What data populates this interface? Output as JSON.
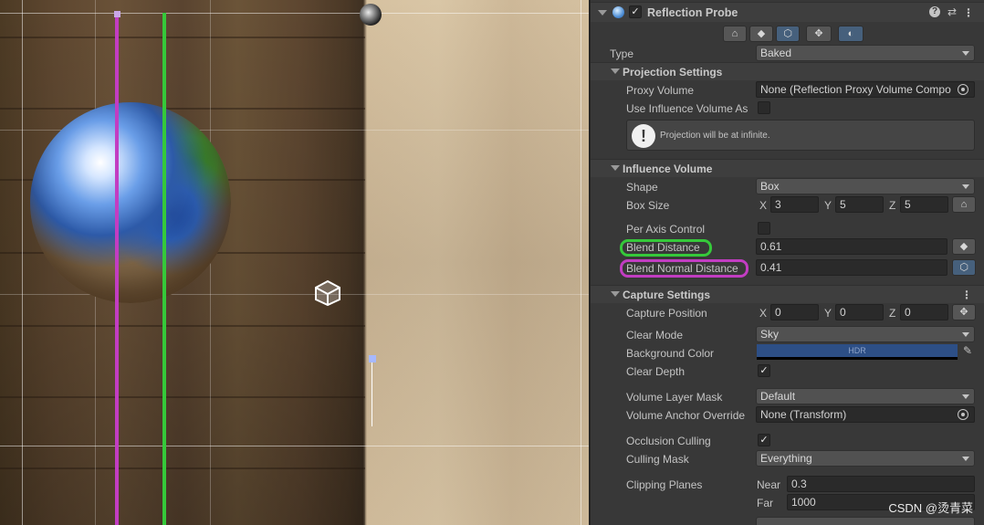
{
  "component": {
    "title": "Reflection Probe",
    "enabled": true
  },
  "type": {
    "label": "Type",
    "value": "Baked"
  },
  "projection": {
    "title": "Projection Settings",
    "proxy_volume_label": "Proxy Volume",
    "proxy_volume_value": "None (Reflection Proxy Volume Compo",
    "use_influence_label": "Use Influence Volume As",
    "use_influence_checked": false,
    "help_text": "Projection will be at infinite."
  },
  "influence": {
    "title": "Influence Volume",
    "shape_label": "Shape",
    "shape_value": "Box",
    "box_size_label": "Box Size",
    "box_size": {
      "x": "3",
      "y": "5",
      "z": "5"
    },
    "per_axis_label": "Per Axis Control",
    "per_axis_checked": false,
    "blend_distance_label": "Blend Distance",
    "blend_distance_value": "0.61",
    "blend_normal_label": "Blend Normal Distance",
    "blend_normal_value": "0.41"
  },
  "capture": {
    "title": "Capture Settings",
    "capture_position_label": "Capture Position",
    "capture_position": {
      "x": "0",
      "y": "0",
      "z": "0"
    },
    "clear_mode_label": "Clear Mode",
    "clear_mode_value": "Sky",
    "background_color_label": "Background Color",
    "background_color_tag": "HDR",
    "background_color_hex": "#2d4f86",
    "clear_depth_label": "Clear Depth",
    "clear_depth_checked": true,
    "volume_layer_mask_label": "Volume Layer Mask",
    "volume_layer_mask_value": "Default",
    "volume_anchor_label": "Volume Anchor Override",
    "volume_anchor_value": "None (Transform)",
    "occlusion_culling_label": "Occlusion Culling",
    "occlusion_culling_checked": true,
    "culling_mask_label": "Culling Mask",
    "culling_mask_value": "Everything",
    "clipping_planes_label": "Clipping Planes",
    "near_label": "Near",
    "near_value": "0.3",
    "far_label": "Far",
    "far_value": "1000"
  },
  "axis_labels": {
    "x": "X",
    "y": "Y",
    "z": "Z"
  },
  "colors": {
    "highlight_blend": "#35c93a",
    "highlight_normal": "#c23dc2"
  },
  "watermark": "CSDN @烫青菜"
}
